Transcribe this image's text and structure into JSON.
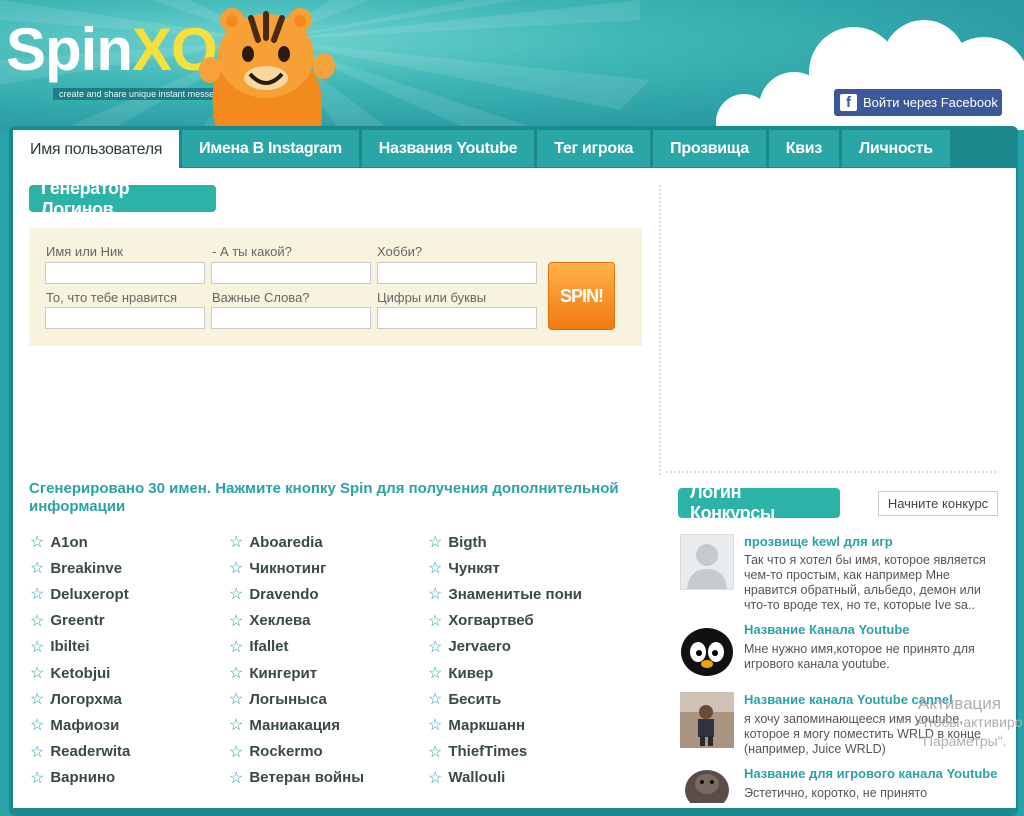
{
  "header": {
    "logo_main": "Spin",
    "logo_accent": "XO",
    "tagline": "create and share unique instant messenger content",
    "facebook_button": "Войти через Facebook",
    "facebook_icon": "f"
  },
  "tabs": [
    {
      "label": "Имя пользователя",
      "active": true
    },
    {
      "label": "Имена В Instagram"
    },
    {
      "label": "Названия Youtube"
    },
    {
      "label": "Тег игрока"
    },
    {
      "label": "Прозвища"
    },
    {
      "label": "Квиз"
    },
    {
      "label": "Личность"
    }
  ],
  "generator": {
    "title": "Генератор Логинов",
    "labels": [
      "Имя или Ник",
      "- А ты какой?",
      "Хобби?",
      "То, что тебе нравится",
      "Важные Слова?",
      "Цифры или буквы"
    ],
    "spin_label": "SPIN!"
  },
  "results": {
    "title": "Сгенерировано 30 имен. Нажмите кнопку Spin для получения дополнительной информации",
    "columns": [
      [
        "A1on",
        "Breakinve",
        "Deluxeropt",
        "Greentr",
        "Ibiltei",
        "Ketobjui",
        "Логорхма",
        "Мафиози",
        "Readerwita",
        "Варнино"
      ],
      [
        "Aboaredia",
        "Чикнотинг",
        "Dravendo",
        "Хеклева",
        "Ifallet",
        "Кингерит",
        "Логыныса",
        "Маниакация",
        "Rockermo",
        "Ветеран войны"
      ],
      [
        "Bigth",
        "Чункят",
        "Знаменитые пони",
        "Хогвартвеб",
        "Jervaero",
        "Кивер",
        "Бесить",
        "Маркшанн",
        "ThiefTimes",
        "Wallouli"
      ]
    ]
  },
  "contests": {
    "title": "Логин Конкурсы",
    "start_button": "Начните конкурс",
    "items": [
      {
        "title": "прозвище kewl для игр",
        "text": "Так что я хотел бы имя, которое является чем-то простым, как например Мне нравится обратный, альбедо, демон или что-то вроде тех, но те, которые Ive sa.."
      },
      {
        "title": "Название Канала Youtube",
        "text": "Мне нужно имя,которое не принято для игрового канала youtube."
      },
      {
        "title": "Название канала Youtube cannel",
        "text": "я хочу запоминающееся имя youtube, которое я могу поместить WRLD в конце (например, Juice WRLD)"
      },
      {
        "title": "Название для игрового канала Youtube",
        "text": "Эстетично, коротко, не принято"
      }
    ]
  },
  "watermark": {
    "line1": "Активация",
    "line2": "Чтобы активиро",
    "line3": "\"Параметры\"."
  }
}
